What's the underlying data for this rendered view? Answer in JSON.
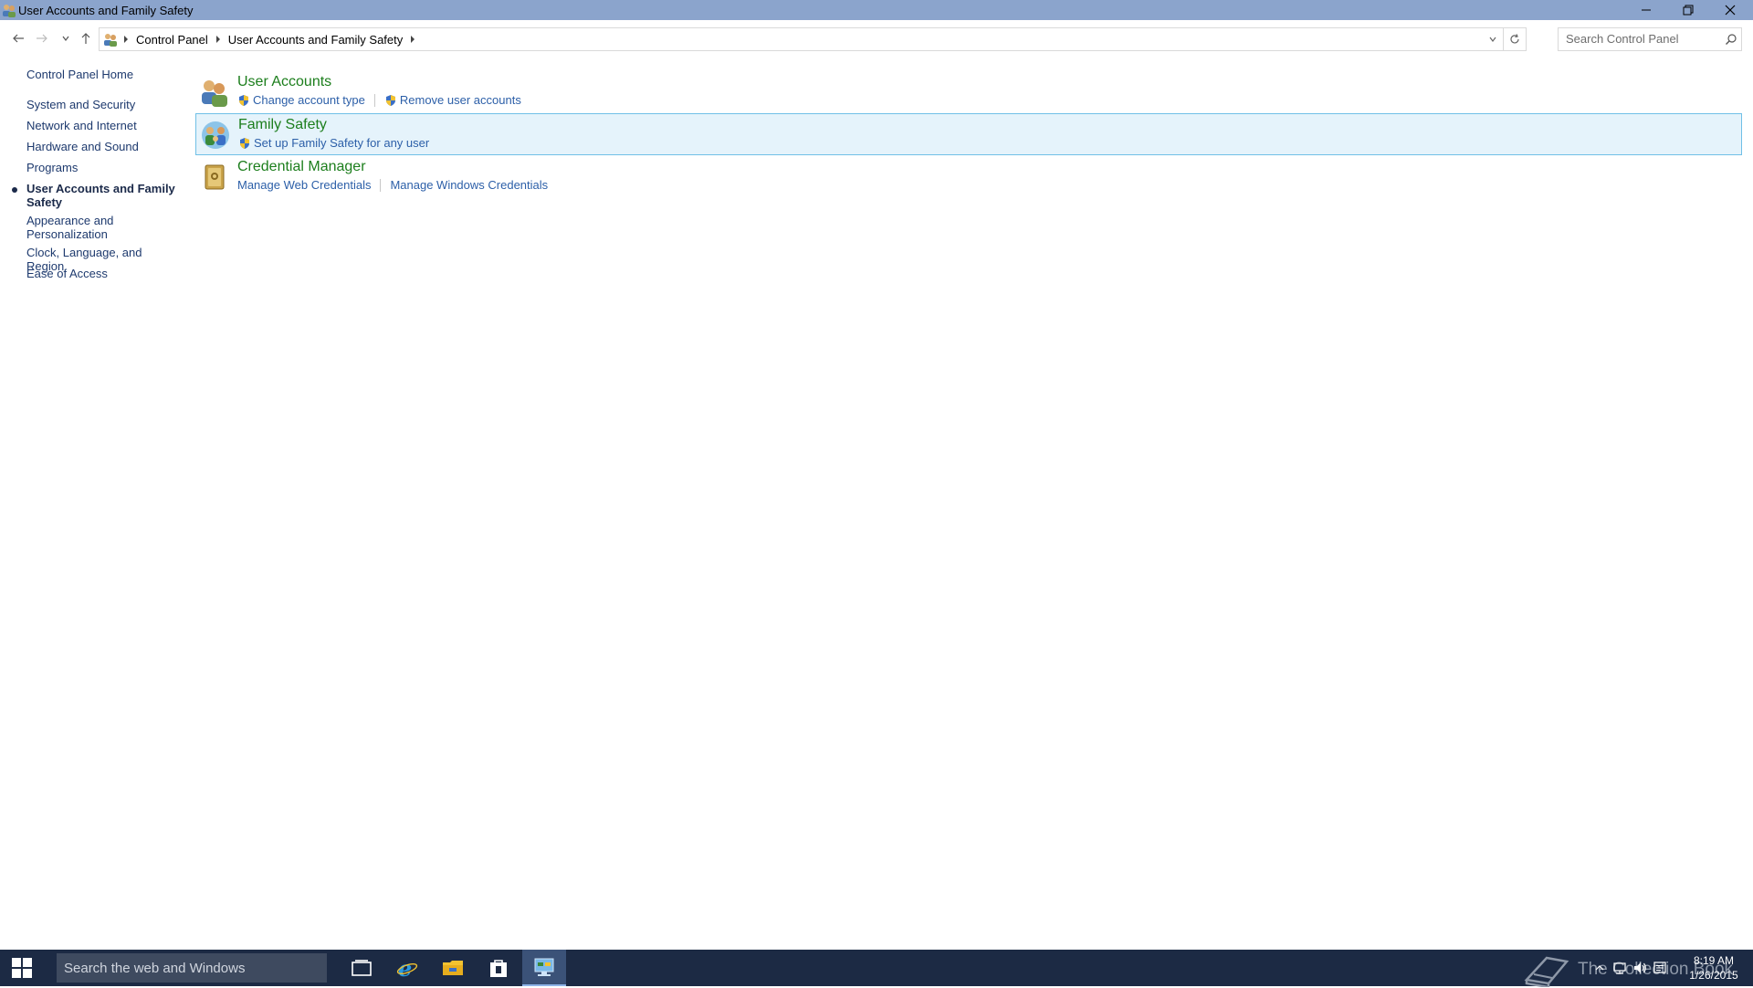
{
  "window": {
    "title": "User Accounts and Family Safety"
  },
  "address": {
    "crumbs": [
      "Control Panel",
      "User Accounts and Family Safety"
    ],
    "search_placeholder": "Search Control Panel"
  },
  "sidebar": {
    "home": "Control Panel Home",
    "items": [
      {
        "label": "System and Security"
      },
      {
        "label": "Network and Internet"
      },
      {
        "label": "Hardware and Sound"
      },
      {
        "label": "Programs"
      },
      {
        "label": "User Accounts and Family Safety",
        "active": true
      },
      {
        "label": "Appearance and Personalization"
      },
      {
        "label": "Clock, Language, and Region"
      },
      {
        "label": "Ease of Access"
      }
    ]
  },
  "categories": [
    {
      "title": "User Accounts",
      "icon": "users-icon",
      "links": [
        {
          "label": "Change account type",
          "shield": true
        },
        {
          "label": "Remove user accounts",
          "shield": true
        }
      ]
    },
    {
      "title": "Family Safety",
      "icon": "family-safety-icon",
      "selected": true,
      "links": [
        {
          "label": "Set up Family Safety for any user",
          "shield": true
        }
      ]
    },
    {
      "title": "Credential Manager",
      "icon": "credential-vault-icon",
      "links": [
        {
          "label": "Manage Web Credentials",
          "shield": false
        },
        {
          "label": "Manage Windows Credentials",
          "shield": false
        }
      ]
    }
  ],
  "taskbar": {
    "search_placeholder": "Search the web and Windows",
    "watermark": "The Collection Book",
    "time": "8:19 AM",
    "date": "1/26/2015"
  },
  "colors": {
    "titlebar": "#8ba4cc",
    "category_title": "#1c7e1c",
    "link": "#2c5fa8",
    "selected_bg": "#e5f3fb",
    "selected_border": "#70c0e7",
    "taskbar": "#1c2a44"
  }
}
